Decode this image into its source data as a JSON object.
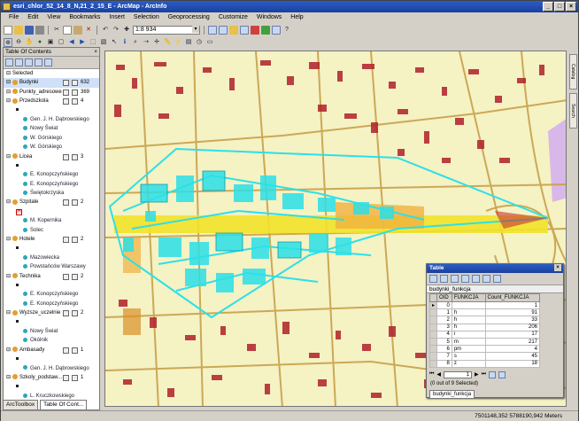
{
  "window": {
    "title": "esri_chlor_52_14_8_N,21_2_15_E - ArcMap - ArcInfo"
  },
  "menu": [
    "File",
    "Edit",
    "View",
    "Bookmarks",
    "Insert",
    "Selection",
    "Geoprocessing",
    "Customize",
    "Windows",
    "Help"
  ],
  "toolbar": {
    "scale": "1:8 934"
  },
  "toc": {
    "title": "Table Of Contents",
    "rows": [
      {
        "type": "header",
        "label": "Selected"
      },
      {
        "type": "layer",
        "label": "Budynki",
        "count": "632",
        "selected": true
      },
      {
        "type": "layer",
        "label": "Punkty_adresowe",
        "count": "369"
      },
      {
        "type": "layer",
        "label": "Przedszkola",
        "count": "4"
      },
      {
        "type": "bullet"
      },
      {
        "type": "sub",
        "label": "Gen. J. H. Dąbrowskiego"
      },
      {
        "type": "sub",
        "label": "Nowy Świat"
      },
      {
        "type": "sub",
        "label": "W. Górskiego"
      },
      {
        "type": "sub",
        "label": "W. Górskiego"
      },
      {
        "type": "layer",
        "label": "Licea",
        "count": "3"
      },
      {
        "type": "bullet"
      },
      {
        "type": "sub",
        "label": "E. Konopczyńskiego"
      },
      {
        "type": "sub",
        "label": "E. Konopczyńskiego"
      },
      {
        "type": "sub",
        "label": "Świętokrzyska"
      },
      {
        "type": "layer",
        "label": "Szpitale",
        "count": "2"
      },
      {
        "type": "hsym"
      },
      {
        "type": "sub",
        "label": "M. Kopernika"
      },
      {
        "type": "sub",
        "label": "Solec"
      },
      {
        "type": "layer",
        "label": "Hotele",
        "count": "2"
      },
      {
        "type": "bullet"
      },
      {
        "type": "sub",
        "label": "Mazowiecka"
      },
      {
        "type": "sub",
        "label": "Powstańców Warszawy"
      },
      {
        "type": "layer",
        "label": "Technika",
        "count": "2"
      },
      {
        "type": "bullet"
      },
      {
        "type": "sub",
        "label": "E. Konopczyńskiego"
      },
      {
        "type": "sub",
        "label": "E. Konopczyńskiego"
      },
      {
        "type": "layer",
        "label": "Wyzsze_uczelnie",
        "count": "2"
      },
      {
        "type": "bullet"
      },
      {
        "type": "sub",
        "label": "Nowy Świat"
      },
      {
        "type": "sub",
        "label": "Okólnik"
      },
      {
        "type": "layer",
        "label": "Ambasady",
        "count": "1"
      },
      {
        "type": "bullet"
      },
      {
        "type": "sub",
        "label": "Gen. J. H. Dąbrowskiego"
      },
      {
        "type": "layer",
        "label": "Szkoly_podstaw...",
        "count": "1"
      },
      {
        "type": "bullet"
      },
      {
        "type": "sub",
        "label": "L. Kruczkowskiego"
      }
    ],
    "tabs": [
      "ArcToolbox",
      "Table Of Cont..."
    ]
  },
  "right_tabs": [
    "Catalog",
    "Search"
  ],
  "table": {
    "title": "Table",
    "layer_name": "budynki_funkcja",
    "headers": [
      "OID",
      "FUNKCJA",
      "Count_FUNKCJA"
    ],
    "rows": [
      [
        "0",
        "",
        "1"
      ],
      [
        "1",
        "h",
        "91"
      ],
      [
        "2",
        "h",
        "33"
      ],
      [
        "3",
        "h",
        "206"
      ],
      [
        "4",
        "i",
        "17"
      ],
      [
        "5",
        "m",
        "217"
      ],
      [
        "6",
        "pm",
        "4"
      ],
      [
        "7",
        "s",
        "45"
      ],
      [
        "8",
        "z",
        "18"
      ]
    ],
    "record": "1",
    "info": "(0 out of 9 Selected)",
    "tab": "budynki_funkcja"
  },
  "status": {
    "coords": "7501148,352  5788190,942 Meters"
  }
}
